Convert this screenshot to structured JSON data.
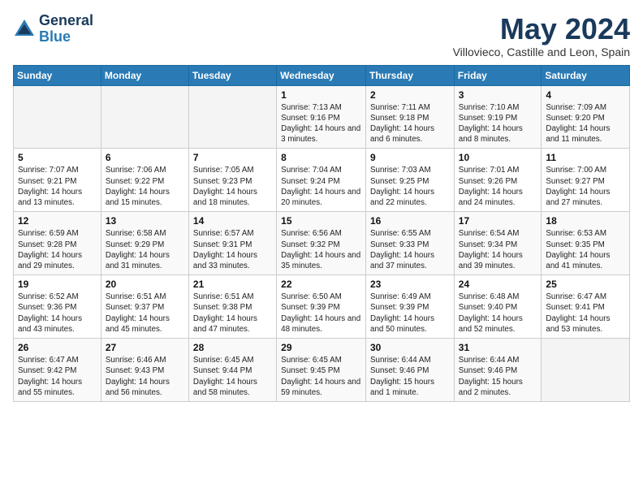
{
  "header": {
    "logo_general": "General",
    "logo_blue": "Blue",
    "month_title": "May 2024",
    "location": "Villovieco, Castille and Leon, Spain"
  },
  "weekdays": [
    "Sunday",
    "Monday",
    "Tuesday",
    "Wednesday",
    "Thursday",
    "Friday",
    "Saturday"
  ],
  "weeks": [
    [
      {
        "day": "",
        "info": ""
      },
      {
        "day": "",
        "info": ""
      },
      {
        "day": "",
        "info": ""
      },
      {
        "day": "1",
        "info": "Sunrise: 7:13 AM\nSunset: 9:16 PM\nDaylight: 14 hours and 3 minutes."
      },
      {
        "day": "2",
        "info": "Sunrise: 7:11 AM\nSunset: 9:18 PM\nDaylight: 14 hours and 6 minutes."
      },
      {
        "day": "3",
        "info": "Sunrise: 7:10 AM\nSunset: 9:19 PM\nDaylight: 14 hours and 8 minutes."
      },
      {
        "day": "4",
        "info": "Sunrise: 7:09 AM\nSunset: 9:20 PM\nDaylight: 14 hours and 11 minutes."
      }
    ],
    [
      {
        "day": "5",
        "info": "Sunrise: 7:07 AM\nSunset: 9:21 PM\nDaylight: 14 hours and 13 minutes."
      },
      {
        "day": "6",
        "info": "Sunrise: 7:06 AM\nSunset: 9:22 PM\nDaylight: 14 hours and 15 minutes."
      },
      {
        "day": "7",
        "info": "Sunrise: 7:05 AM\nSunset: 9:23 PM\nDaylight: 14 hours and 18 minutes."
      },
      {
        "day": "8",
        "info": "Sunrise: 7:04 AM\nSunset: 9:24 PM\nDaylight: 14 hours and 20 minutes."
      },
      {
        "day": "9",
        "info": "Sunrise: 7:03 AM\nSunset: 9:25 PM\nDaylight: 14 hours and 22 minutes."
      },
      {
        "day": "10",
        "info": "Sunrise: 7:01 AM\nSunset: 9:26 PM\nDaylight: 14 hours and 24 minutes."
      },
      {
        "day": "11",
        "info": "Sunrise: 7:00 AM\nSunset: 9:27 PM\nDaylight: 14 hours and 27 minutes."
      }
    ],
    [
      {
        "day": "12",
        "info": "Sunrise: 6:59 AM\nSunset: 9:28 PM\nDaylight: 14 hours and 29 minutes."
      },
      {
        "day": "13",
        "info": "Sunrise: 6:58 AM\nSunset: 9:29 PM\nDaylight: 14 hours and 31 minutes."
      },
      {
        "day": "14",
        "info": "Sunrise: 6:57 AM\nSunset: 9:31 PM\nDaylight: 14 hours and 33 minutes."
      },
      {
        "day": "15",
        "info": "Sunrise: 6:56 AM\nSunset: 9:32 PM\nDaylight: 14 hours and 35 minutes."
      },
      {
        "day": "16",
        "info": "Sunrise: 6:55 AM\nSunset: 9:33 PM\nDaylight: 14 hours and 37 minutes."
      },
      {
        "day": "17",
        "info": "Sunrise: 6:54 AM\nSunset: 9:34 PM\nDaylight: 14 hours and 39 minutes."
      },
      {
        "day": "18",
        "info": "Sunrise: 6:53 AM\nSunset: 9:35 PM\nDaylight: 14 hours and 41 minutes."
      }
    ],
    [
      {
        "day": "19",
        "info": "Sunrise: 6:52 AM\nSunset: 9:36 PM\nDaylight: 14 hours and 43 minutes."
      },
      {
        "day": "20",
        "info": "Sunrise: 6:51 AM\nSunset: 9:37 PM\nDaylight: 14 hours and 45 minutes."
      },
      {
        "day": "21",
        "info": "Sunrise: 6:51 AM\nSunset: 9:38 PM\nDaylight: 14 hours and 47 minutes."
      },
      {
        "day": "22",
        "info": "Sunrise: 6:50 AM\nSunset: 9:39 PM\nDaylight: 14 hours and 48 minutes."
      },
      {
        "day": "23",
        "info": "Sunrise: 6:49 AM\nSunset: 9:39 PM\nDaylight: 14 hours and 50 minutes."
      },
      {
        "day": "24",
        "info": "Sunrise: 6:48 AM\nSunset: 9:40 PM\nDaylight: 14 hours and 52 minutes."
      },
      {
        "day": "25",
        "info": "Sunrise: 6:47 AM\nSunset: 9:41 PM\nDaylight: 14 hours and 53 minutes."
      }
    ],
    [
      {
        "day": "26",
        "info": "Sunrise: 6:47 AM\nSunset: 9:42 PM\nDaylight: 14 hours and 55 minutes."
      },
      {
        "day": "27",
        "info": "Sunrise: 6:46 AM\nSunset: 9:43 PM\nDaylight: 14 hours and 56 minutes."
      },
      {
        "day": "28",
        "info": "Sunrise: 6:45 AM\nSunset: 9:44 PM\nDaylight: 14 hours and 58 minutes."
      },
      {
        "day": "29",
        "info": "Sunrise: 6:45 AM\nSunset: 9:45 PM\nDaylight: 14 hours and 59 minutes."
      },
      {
        "day": "30",
        "info": "Sunrise: 6:44 AM\nSunset: 9:46 PM\nDaylight: 15 hours and 1 minute."
      },
      {
        "day": "31",
        "info": "Sunrise: 6:44 AM\nSunset: 9:46 PM\nDaylight: 15 hours and 2 minutes."
      },
      {
        "day": "",
        "info": ""
      }
    ]
  ]
}
